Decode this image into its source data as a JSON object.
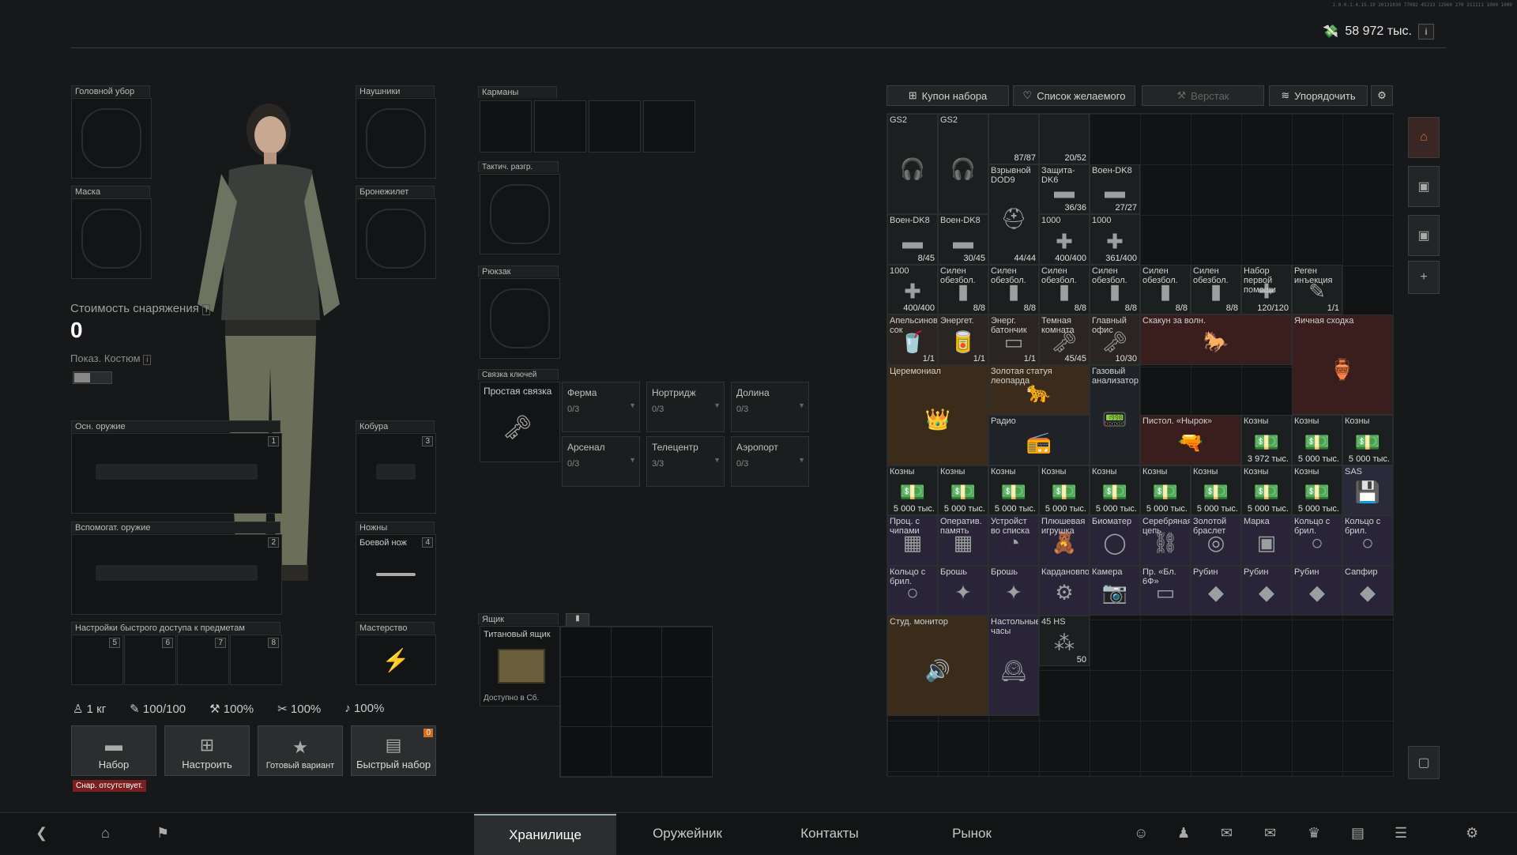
{
  "header": {
    "money": "58 972 тыс.",
    "money_info": "i",
    "build": "1.0.0.1.4.15.19 20131030 77082 45213 12960 270 211111 1000 1000"
  },
  "slots": {
    "headwear": "Головной убор",
    "headphones": "Наушники",
    "mask": "Маска",
    "vest": "Бронежилет",
    "primary": "Осн. оружие",
    "primary_num": "1",
    "holster": "Кобура",
    "holster_num": "3",
    "secondary": "Вспомогат. оружие",
    "secondary_num": "2",
    "sheath": "Ножны",
    "sheath_num": "4",
    "knife": "Боевой нож",
    "quick": "Настройки быстрого доступа к предметам",
    "quick_nums": [
      "5",
      "6",
      "7",
      "8"
    ],
    "mastery": "Мастерство"
  },
  "cost": {
    "label": "Стоимость снаряжения",
    "value": "0",
    "costume": "Показ. Костюм"
  },
  "stats": [
    "1 кг",
    "100/100",
    "100%",
    "100%",
    "100%"
  ],
  "buttons": {
    "loadout": "Набор",
    "configure": "Настроить",
    "ready": "Готовый вариант",
    "quick": "Быстрый набор",
    "quick_badge": "0",
    "missing": "Снар. отсутствует."
  },
  "middle": {
    "pockets": "Карманы",
    "rig": "Тактич. разгр.",
    "backpack": "Рюкзак",
    "keyring": "Связка ключей",
    "simple_key": "Простая связка",
    "keys": [
      {
        "name": "Ферма",
        "count": "0/3"
      },
      {
        "name": "Нортридж",
        "count": "0/3"
      },
      {
        "name": "Долина",
        "count": "0/3"
      },
      {
        "name": "Арсенал",
        "count": "0/3"
      },
      {
        "name": "Телецентр",
        "count": "3/3"
      },
      {
        "name": "Аэропорт",
        "count": "0/3"
      }
    ],
    "box": "Ящик",
    "titan": "Титановый ящик",
    "avail": "Доступно в Сб."
  },
  "toolbar": {
    "coupon": "Купон набора",
    "wishlist": "Список желаемого",
    "workbench": "Верстак",
    "sort": "Упорядочить"
  },
  "items": [
    {
      "n": "GS2",
      "c": "",
      "g": "🎧",
      "col": 0,
      "row": 0,
      "w": 1,
      "h": 2,
      "bg": "#1c1f20"
    },
    {
      "n": "GS2",
      "c": "",
      "g": "🎧",
      "col": 1,
      "row": 0,
      "w": 1,
      "h": 2,
      "bg": "#1c1f20"
    },
    {
      "n": "",
      "c": "87/87",
      "g": "",
      "col": 2,
      "row": 0,
      "w": 1,
      "h": 1,
      "bg": "#1c1f20"
    },
    {
      "n": "",
      "c": "20/52",
      "g": "",
      "col": 3,
      "row": 0,
      "w": 1,
      "h": 1,
      "bg": "#1c1f20"
    },
    {
      "n": "Взрывной DOD9",
      "c": "44/44",
      "g": "⛑",
      "col": 2,
      "row": 1,
      "w": 1,
      "h": 2,
      "bg": "#1c1f20"
    },
    {
      "n": "Защита-DK6",
      "c": "36/36",
      "g": "▬",
      "col": 3,
      "row": 1,
      "w": 1,
      "h": 1,
      "bg": "#1c1f20"
    },
    {
      "n": "Воен-DK8",
      "c": "27/27",
      "g": "▬",
      "col": 4,
      "row": 1,
      "w": 1,
      "h": 1,
      "bg": "#1c1f20"
    },
    {
      "n": "Воен-DK8",
      "c": "8/45",
      "g": "▬",
      "col": 0,
      "row": 2,
      "w": 1,
      "h": 1,
      "bg": "#1c1f20"
    },
    {
      "n": "Воен-DK8",
      "c": "30/45",
      "g": "▬",
      "col": 1,
      "row": 2,
      "w": 1,
      "h": 1,
      "bg": "#1c1f20"
    },
    {
      "n": "1000",
      "c": "400/400",
      "g": "✚",
      "col": 3,
      "row": 2,
      "w": 1,
      "h": 1,
      "bg": "#1c1f20"
    },
    {
      "n": "1000",
      "c": "361/400",
      "g": "✚",
      "col": 4,
      "row": 2,
      "w": 1,
      "h": 1,
      "bg": "#1c1f20"
    },
    {
      "n": "1000",
      "c": "400/400",
      "g": "✚",
      "col": 0,
      "row": 3,
      "w": 1,
      "h": 1,
      "bg": "#1c1f20"
    },
    {
      "n": "Силен обезбол.",
      "c": "8/8",
      "g": "▮",
      "col": 1,
      "row": 3,
      "w": 1,
      "h": 1,
      "bg": "#1c1f20"
    },
    {
      "n": "Силен обезбол.",
      "c": "8/8",
      "g": "▮",
      "col": 2,
      "row": 3,
      "w": 1,
      "h": 1,
      "bg": "#1c1f20"
    },
    {
      "n": "Силен обезбол.",
      "c": "8/8",
      "g": "▮",
      "col": 3,
      "row": 3,
      "w": 1,
      "h": 1,
      "bg": "#1c1f20"
    },
    {
      "n": "Силен обезбол.",
      "c": "8/8",
      "g": "▮",
      "col": 4,
      "row": 3,
      "w": 1,
      "h": 1,
      "bg": "#1c1f20"
    },
    {
      "n": "Силен обезбол.",
      "c": "8/8",
      "g": "▮",
      "col": 5,
      "row": 3,
      "w": 1,
      "h": 1,
      "bg": "#1c1f20"
    },
    {
      "n": "Силен обезбол.",
      "c": "8/8",
      "g": "▮",
      "col": 6,
      "row": 3,
      "w": 1,
      "h": 1,
      "bg": "#1c1f20"
    },
    {
      "n": "Набор первой помощи",
      "c": "120/120",
      "g": "✚",
      "col": 7,
      "row": 3,
      "w": 1,
      "h": 1,
      "bg": "#1c1f20"
    },
    {
      "n": "Реген инъекция",
      "c": "1/1",
      "g": "✎",
      "col": 8,
      "row": 3,
      "w": 1,
      "h": 1,
      "bg": "#1c1f20"
    },
    {
      "n": "Апельсиновый сок",
      "c": "1/1",
      "g": "🥤",
      "col": 0,
      "row": 4,
      "w": 1,
      "h": 1,
      "bg": "#2a2422"
    },
    {
      "n": "Энергет.",
      "c": "1/1",
      "g": "🥫",
      "col": 1,
      "row": 4,
      "w": 1,
      "h": 1,
      "bg": "#2a2422"
    },
    {
      "n": "Энерг. батончик",
      "c": "1/1",
      "g": "▭",
      "col": 2,
      "row": 4,
      "w": 1,
      "h": 1,
      "bg": "#2a2422"
    },
    {
      "n": "Темная комната",
      "c": "45/45",
      "g": "🗝",
      "col": 3,
      "row": 4,
      "w": 1,
      "h": 1,
      "bg": "#2a2422"
    },
    {
      "n": "Главный офис",
      "c": "10/30",
      "g": "🗝",
      "col": 4,
      "row": 4,
      "w": 1,
      "h": 1,
      "bg": "#2a2422"
    },
    {
      "n": "Скакун за волн.",
      "c": "",
      "g": "🐎",
      "col": 5,
      "row": 4,
      "w": 3,
      "h": 1,
      "bg": "#3a1e1e"
    },
    {
      "n": "Яичная сходка",
      "c": "",
      "g": "🏺",
      "col": 8,
      "row": 4,
      "w": 2,
      "h": 2,
      "bg": "#3a1e1e"
    },
    {
      "n": "Церемониал",
      "c": "",
      "g": "👑",
      "col": 0,
      "row": 5,
      "w": 2,
      "h": 2,
      "bg": "#3a2b1a"
    },
    {
      "n": "Золотая статуя леопарда",
      "c": "",
      "g": "🐆",
      "col": 2,
      "row": 5,
      "w": 2,
      "h": 1,
      "bg": "#3a2b1a"
    },
    {
      "n": "Газовый анализатор",
      "c": "",
      "g": "📟",
      "col": 4,
      "row": 5,
      "w": 1,
      "h": 2,
      "bg": "#1f2328"
    },
    {
      "n": "Радио",
      "c": "",
      "g": "📻",
      "col": 2,
      "row": 6,
      "w": 2,
      "h": 1,
      "bg": "#1f2328"
    },
    {
      "n": "Пистол. «Нырок»",
      "c": "",
      "g": "🔫",
      "col": 5,
      "row": 6,
      "w": 2,
      "h": 1,
      "bg": "#3a1e1e"
    },
    {
      "n": "Козны",
      "c": "3 972 тыс.",
      "g": "💵",
      "col": 7,
      "row": 6,
      "w": 1,
      "h": 1,
      "bg": "#1c1f20"
    },
    {
      "n": "Козны",
      "c": "5 000 тыс.",
      "g": "💵",
      "col": 8,
      "row": 6,
      "w": 1,
      "h": 1,
      "bg": "#1c1f20"
    },
    {
      "n": "Козны",
      "c": "5 000 тыс.",
      "g": "💵",
      "col": 9,
      "row": 6,
      "w": 1,
      "h": 1,
      "bg": "#1c1f20"
    },
    {
      "n": "Козны",
      "c": "5 000 тыс.",
      "g": "💵",
      "col": 0,
      "row": 7,
      "w": 1,
      "h": 1,
      "bg": "#1c1f20"
    },
    {
      "n": "Козны",
      "c": "5 000 тыс.",
      "g": "💵",
      "col": 1,
      "row": 7,
      "w": 1,
      "h": 1,
      "bg": "#1c1f20"
    },
    {
      "n": "Козны",
      "c": "5 000 тыс.",
      "g": "💵",
      "col": 2,
      "row": 7,
      "w": 1,
      "h": 1,
      "bg": "#1c1f20"
    },
    {
      "n": "Козны",
      "c": "5 000 тыс.",
      "g": "💵",
      "col": 3,
      "row": 7,
      "w": 1,
      "h": 1,
      "bg": "#1c1f20"
    },
    {
      "n": "Козны",
      "c": "5 000 тыс.",
      "g": "💵",
      "col": 4,
      "row": 7,
      "w": 1,
      "h": 1,
      "bg": "#1c1f20"
    },
    {
      "n": "Козны",
      "c": "5 000 тыс.",
      "g": "💵",
      "col": 5,
      "row": 7,
      "w": 1,
      "h": 1,
      "bg": "#1c1f20"
    },
    {
      "n": "Козны",
      "c": "5 000 тыс.",
      "g": "💵",
      "col": 6,
      "row": 7,
      "w": 1,
      "h": 1,
      "bg": "#1c1f20"
    },
    {
      "n": "Козны",
      "c": "5 000 тыс.",
      "g": "💵",
      "col": 7,
      "row": 7,
      "w": 1,
      "h": 1,
      "bg": "#1c1f20"
    },
    {
      "n": "Козны",
      "c": "5 000 тыс.",
      "g": "💵",
      "col": 8,
      "row": 7,
      "w": 1,
      "h": 1,
      "bg": "#1c1f20"
    },
    {
      "n": "SAS",
      "c": "",
      "g": "💾",
      "col": 9,
      "row": 7,
      "w": 1,
      "h": 1,
      "bg": "#2a2a3a"
    },
    {
      "n": "Проц. с чипами",
      "c": "",
      "g": "▦",
      "col": 0,
      "row": 8,
      "w": 1,
      "h": 1,
      "bg": "#2a2438"
    },
    {
      "n": "Оператив. память",
      "c": "",
      "g": "▦",
      "col": 1,
      "row": 8,
      "w": 1,
      "h": 1,
      "bg": "#2a2438"
    },
    {
      "n": "Устройст во списка",
      "c": "",
      "g": "◔",
      "col": 2,
      "row": 8,
      "w": 1,
      "h": 1,
      "bg": "#2a2438"
    },
    {
      "n": "Плюшевая игрушка",
      "c": "",
      "g": "🧸",
      "col": 3,
      "row": 8,
      "w": 1,
      "h": 1,
      "bg": "#2a2438"
    },
    {
      "n": "Биоматер",
      "c": "",
      "g": "◯",
      "col": 4,
      "row": 8,
      "w": 1,
      "h": 1,
      "bg": "#2a2438"
    },
    {
      "n": "Серебряная цепь",
      "c": "",
      "g": "⛓",
      "col": 5,
      "row": 8,
      "w": 1,
      "h": 1,
      "bg": "#2a2438"
    },
    {
      "n": "Золотой браслет",
      "c": "",
      "g": "◎",
      "col": 6,
      "row": 8,
      "w": 1,
      "h": 1,
      "bg": "#2a2438"
    },
    {
      "n": "Марка",
      "c": "",
      "g": "▣",
      "col": 7,
      "row": 8,
      "w": 1,
      "h": 1,
      "bg": "#2a2438"
    },
    {
      "n": "Кольцо с брил.",
      "c": "",
      "g": "○",
      "col": 8,
      "row": 8,
      "w": 1,
      "h": 1,
      "bg": "#2a2438"
    },
    {
      "n": "Кольцо с брил.",
      "c": "",
      "g": "○",
      "col": 9,
      "row": 8,
      "w": 1,
      "h": 1,
      "bg": "#2a2438"
    },
    {
      "n": "Кольцо с брил.",
      "c": "",
      "g": "○",
      "col": 0,
      "row": 9,
      "w": 1,
      "h": 1,
      "bg": "#2a2438"
    },
    {
      "n": "Брошь",
      "c": "",
      "g": "✦",
      "col": 1,
      "row": 9,
      "w": 1,
      "h": 1,
      "bg": "#2a2438"
    },
    {
      "n": "Брошь",
      "c": "",
      "g": "✦",
      "col": 2,
      "row": 9,
      "w": 1,
      "h": 1,
      "bg": "#2a2438"
    },
    {
      "n": "Кардановподвес",
      "c": "",
      "g": "⚙",
      "col": 3,
      "row": 9,
      "w": 1,
      "h": 1,
      "bg": "#2a2438"
    },
    {
      "n": "Камера",
      "c": "",
      "g": "📷",
      "col": 4,
      "row": 9,
      "w": 1,
      "h": 1,
      "bg": "#2a2438"
    },
    {
      "n": "Пр. «Бл. 6Ф»",
      "c": "",
      "g": "▭",
      "col": 5,
      "row": 9,
      "w": 1,
      "h": 1,
      "bg": "#2a2438"
    },
    {
      "n": "Рубин",
      "c": "",
      "g": "◆",
      "col": 6,
      "row": 9,
      "w": 1,
      "h": 1,
      "bg": "#2a2438"
    },
    {
      "n": "Рубин",
      "c": "",
      "g": "◆",
      "col": 7,
      "row": 9,
      "w": 1,
      "h": 1,
      "bg": "#2a2438"
    },
    {
      "n": "Рубин",
      "c": "",
      "g": "◆",
      "col": 8,
      "row": 9,
      "w": 1,
      "h": 1,
      "bg": "#2a2438"
    },
    {
      "n": "Сапфир",
      "c": "",
      "g": "◆",
      "col": 9,
      "row": 9,
      "w": 1,
      "h": 1,
      "bg": "#2a2438"
    },
    {
      "n": "Студ. монитор",
      "c": "",
      "g": "🔊",
      "col": 0,
      "row": 10,
      "w": 2,
      "h": 2,
      "bg": "#3a2b1a"
    },
    {
      "n": "Настольные часы",
      "c": "",
      "g": "🕰",
      "col": 2,
      "row": 10,
      "w": 1,
      "h": 2,
      "bg": "#2a2438"
    },
    {
      "n": "45 HS",
      "c": "50",
      "g": "⁂",
      "col": 3,
      "row": 10,
      "w": 1,
      "h": 1,
      "bg": "#1c1f20"
    }
  ],
  "nav": {
    "storage": "Хранилище",
    "gunsmith": "Оружейник",
    "contacts": "Контакты",
    "market": "Рынок"
  }
}
